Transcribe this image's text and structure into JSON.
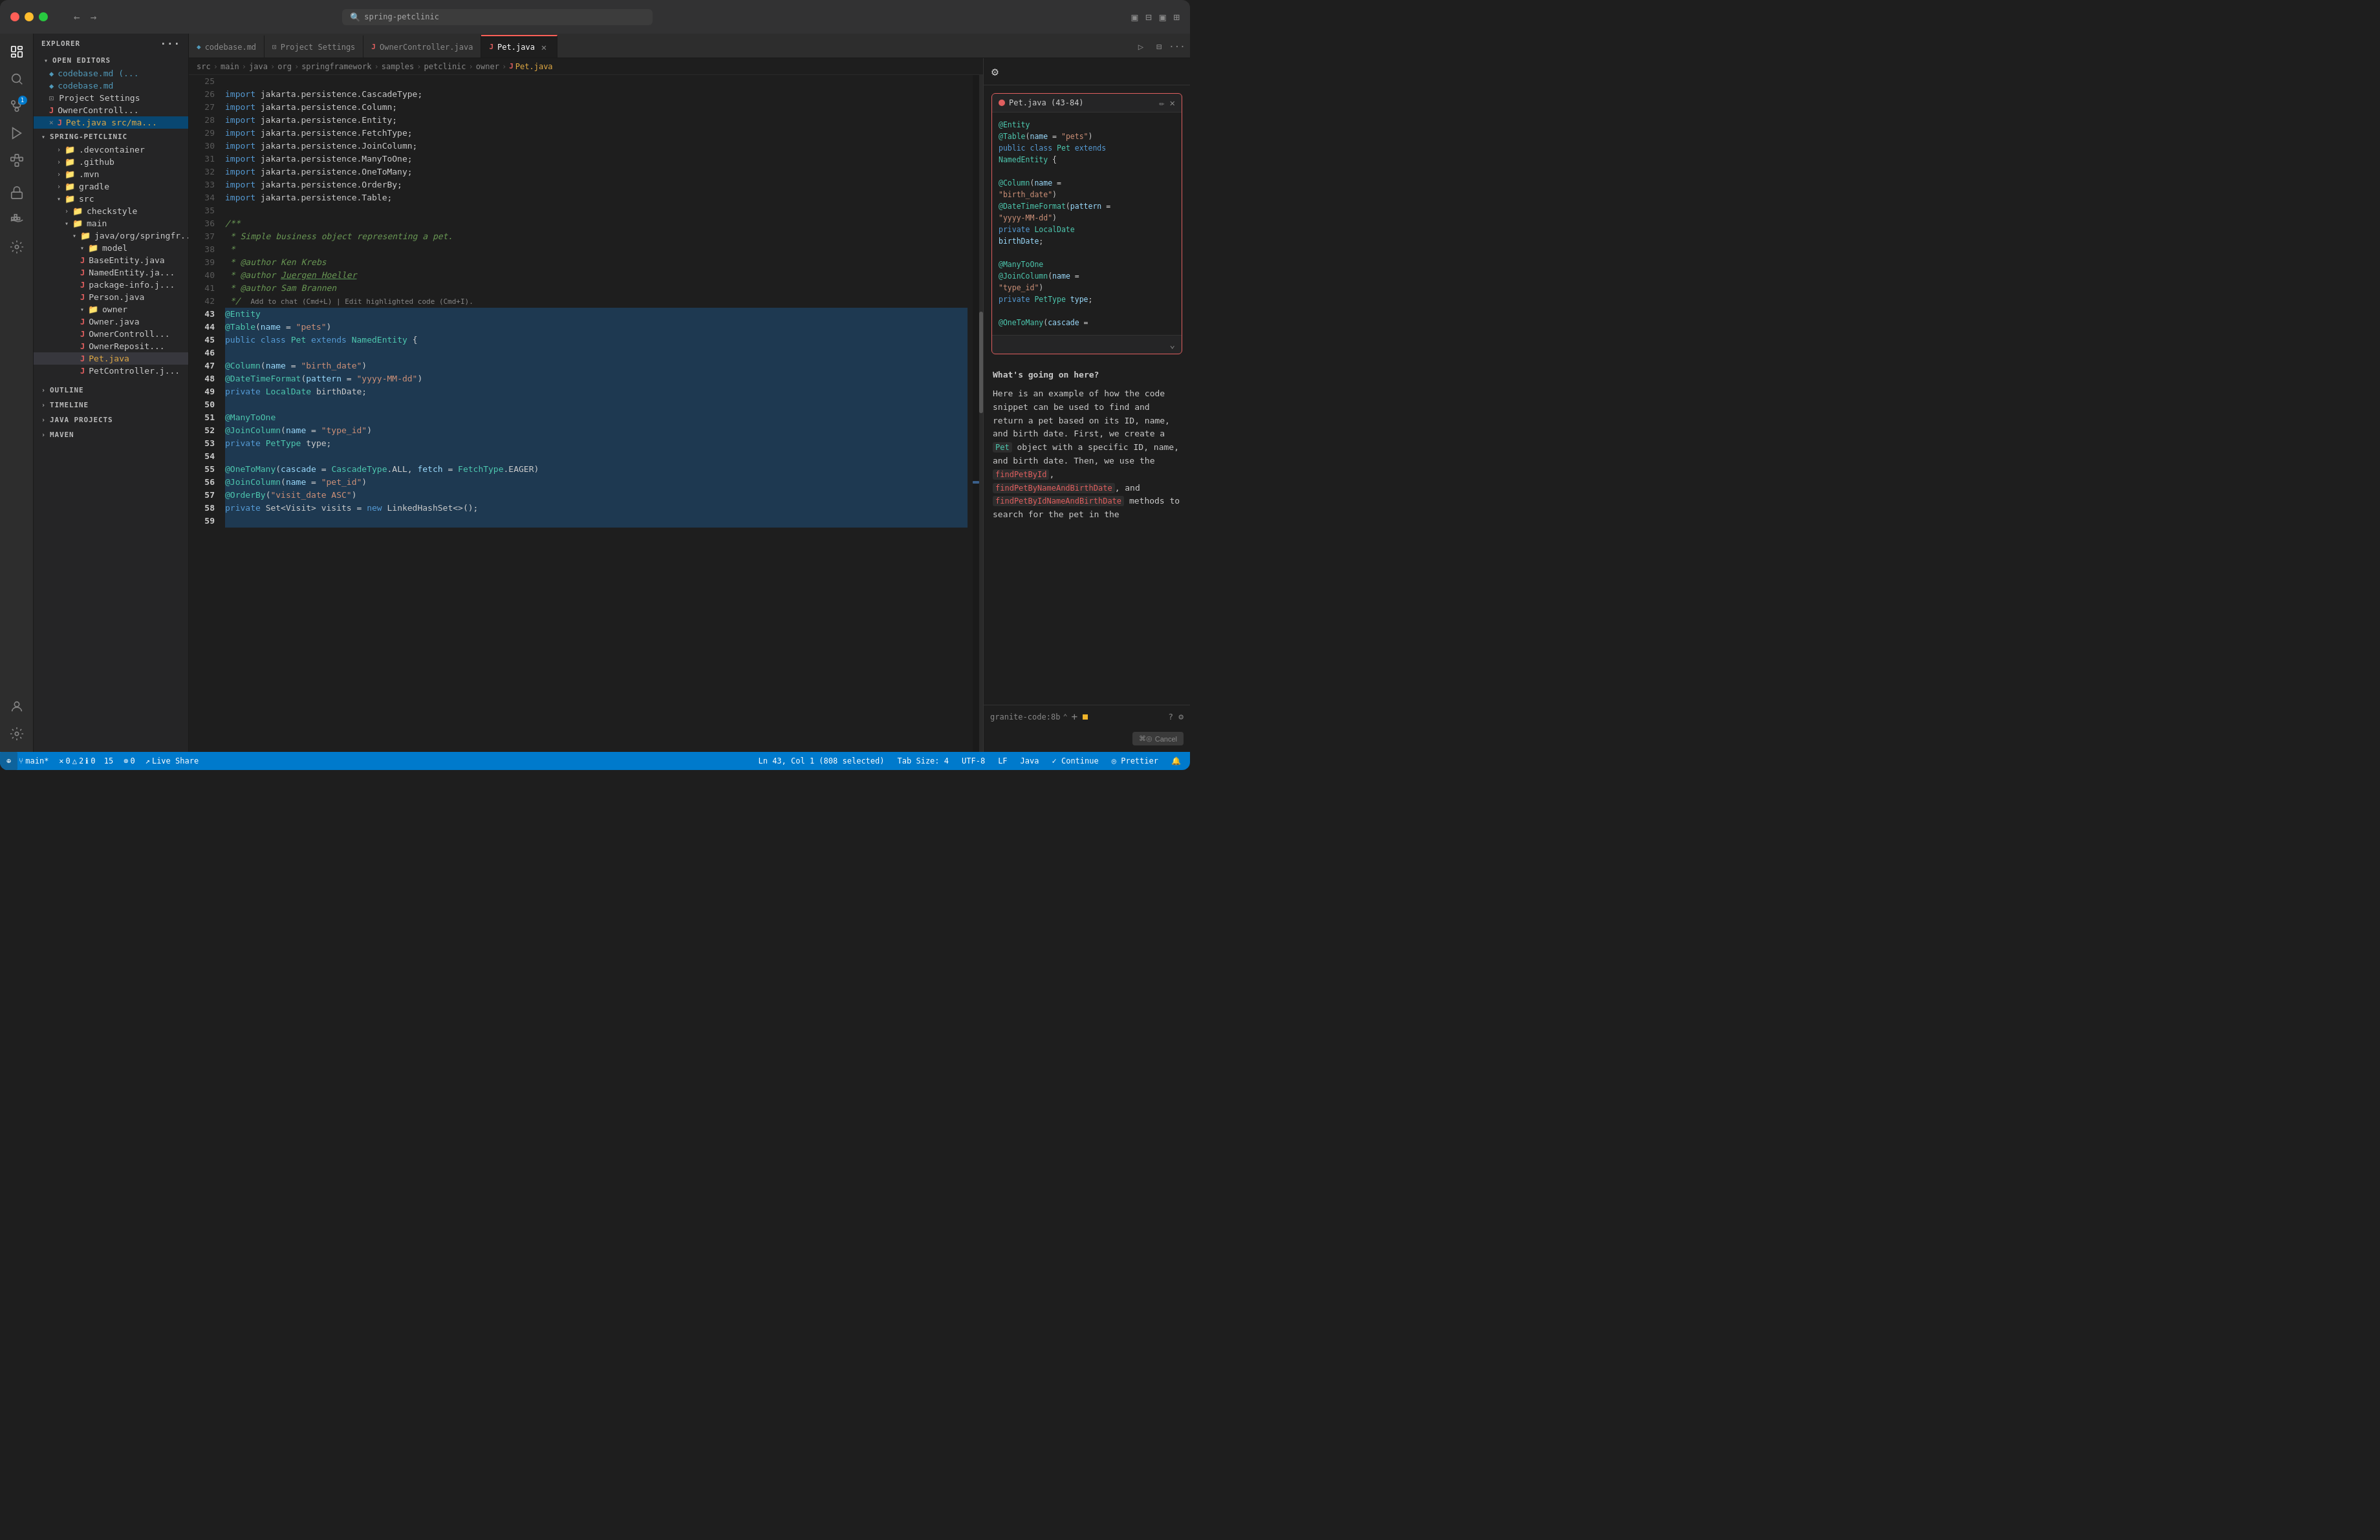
{
  "titlebar": {
    "search_placeholder": "spring-petclinic",
    "nav_back": "←",
    "nav_forward": "→"
  },
  "tabs": {
    "items": [
      {
        "id": "codebase-md",
        "label": "codebase.md",
        "icon": "md",
        "active": false,
        "modified": false
      },
      {
        "id": "project-settings",
        "label": "Project Settings",
        "icon": "settings",
        "active": false,
        "modified": false
      },
      {
        "id": "owner-controller",
        "label": "OwnerController.java",
        "icon": "java",
        "active": false,
        "modified": false
      },
      {
        "id": "pet-java",
        "label": "Pet.java",
        "icon": "java",
        "active": true,
        "modified": true
      }
    ]
  },
  "breadcrumb": {
    "parts": [
      "src",
      "main",
      "java",
      "org",
      "springframework",
      "samples",
      "petclinic",
      "owner",
      "Pet.java"
    ]
  },
  "sidebar": {
    "explorer_label": "EXPLORER",
    "open_editors_label": "OPEN EDITORS",
    "project_label": "SPRING-PETCLINIC",
    "outline_label": "OUTLINE",
    "timeline_label": "TIMELINE",
    "java_projects_label": "JAVA PROJECTS",
    "maven_label": "MAVEN",
    "files": [
      {
        "name": "codebase.md (...",
        "type": "md",
        "indent": 1
      },
      {
        "name": "codebase.md",
        "type": "md",
        "indent": 1
      },
      {
        "name": "Project Settings",
        "type": "settings",
        "indent": 1
      },
      {
        "name": "OwnerControll...",
        "type": "java",
        "indent": 1
      },
      {
        "name": "Pet.java src/ma...",
        "type": "java",
        "indent": 1,
        "active": true,
        "modified": true
      },
      {
        "name": ".devcontainer",
        "type": "folder",
        "indent": 2
      },
      {
        "name": ".github",
        "type": "folder",
        "indent": 2
      },
      {
        "name": ".mvn",
        "type": "folder",
        "indent": 2
      },
      {
        "name": "gradle",
        "type": "folder",
        "indent": 2
      },
      {
        "name": "src",
        "type": "folder",
        "indent": 2,
        "open": true
      },
      {
        "name": "checkstyle",
        "type": "folder",
        "indent": 3
      },
      {
        "name": "main",
        "type": "folder",
        "indent": 3,
        "open": true
      },
      {
        "name": "java/org/springfr...",
        "type": "folder",
        "indent": 4,
        "open": true
      },
      {
        "name": "model",
        "type": "folder",
        "indent": 5,
        "open": true
      },
      {
        "name": "BaseEntity.java",
        "type": "java",
        "indent": 6
      },
      {
        "name": "NamedEntity.ja...",
        "type": "java",
        "indent": 6
      },
      {
        "name": "package-info.j...",
        "type": "java",
        "indent": 6
      },
      {
        "name": "Person.java",
        "type": "java",
        "indent": 6
      },
      {
        "name": "owner",
        "type": "folder",
        "indent": 5,
        "open": true
      },
      {
        "name": "Owner.java",
        "type": "java",
        "indent": 6
      },
      {
        "name": "OwnerControll...",
        "type": "java",
        "indent": 6
      },
      {
        "name": "OwnerReposit...",
        "type": "java",
        "indent": 6
      },
      {
        "name": "Pet.java",
        "type": "java",
        "indent": 6,
        "active": true
      },
      {
        "name": "PetController.j...",
        "type": "java",
        "indent": 6
      }
    ]
  },
  "code": {
    "lines": [
      {
        "num": 25,
        "content": ""
      },
      {
        "num": 26,
        "tokens": [
          {
            "t": "kw",
            "v": "import"
          },
          {
            "t": "punct",
            "v": " jakarta.persistence.CascadeType;"
          }
        ]
      },
      {
        "num": 27,
        "tokens": [
          {
            "t": "kw",
            "v": "import"
          },
          {
            "t": "punct",
            "v": " jakarta.persistence.Column;"
          }
        ]
      },
      {
        "num": 28,
        "tokens": [
          {
            "t": "kw",
            "v": "import"
          },
          {
            "t": "punct",
            "v": " jakarta.persistence.Entity;"
          }
        ]
      },
      {
        "num": 29,
        "tokens": [
          {
            "t": "kw",
            "v": "import"
          },
          {
            "t": "punct",
            "v": " jakarta.persistence.FetchType;"
          }
        ]
      },
      {
        "num": 30,
        "tokens": [
          {
            "t": "kw",
            "v": "import"
          },
          {
            "t": "punct",
            "v": " jakarta.persistence.JoinColumn;"
          }
        ]
      },
      {
        "num": 31,
        "tokens": [
          {
            "t": "kw",
            "v": "import"
          },
          {
            "t": "punct",
            "v": " jakarta.persistence.ManyToOne;"
          }
        ]
      },
      {
        "num": 32,
        "tokens": [
          {
            "t": "kw",
            "v": "import"
          },
          {
            "t": "punct",
            "v": " jakarta.persistence.OneToMany;"
          }
        ]
      },
      {
        "num": 33,
        "tokens": [
          {
            "t": "kw",
            "v": "import"
          },
          {
            "t": "punct",
            "v": " jakarta.persistence.OrderBy;"
          }
        ]
      },
      {
        "num": 34,
        "tokens": [
          {
            "t": "kw",
            "v": "import"
          },
          {
            "t": "punct",
            "v": " jakarta.persistence.Table;"
          }
        ]
      },
      {
        "num": 35,
        "content": ""
      },
      {
        "num": 36,
        "tokens": [
          {
            "t": "comment",
            "v": "/**"
          }
        ]
      },
      {
        "num": 37,
        "tokens": [
          {
            "t": "comment",
            "v": " * Simple business object representing a pet."
          }
        ]
      },
      {
        "num": 38,
        "tokens": [
          {
            "t": "comment",
            "v": " *"
          }
        ]
      },
      {
        "num": 39,
        "tokens": [
          {
            "t": "comment",
            "v": " * @author Ken Krebs"
          }
        ]
      },
      {
        "num": 40,
        "tokens": [
          {
            "t": "comment",
            "v": " * @author Juergen Hoeller"
          }
        ]
      },
      {
        "num": 41,
        "tokens": [
          {
            "t": "comment",
            "v": " * @author Sam Brannen"
          }
        ]
      },
      {
        "num": 42,
        "tokens": [
          {
            "t": "comment",
            "v": " */"
          }
        ],
        "suffix": "     Add to chat (Cmd+L) | Edit highlighted code (Cmd+I)."
      },
      {
        "num": 43,
        "tokens": [
          {
            "t": "ann",
            "v": "@Entity"
          }
        ],
        "highlight": true
      },
      {
        "num": 44,
        "tokens": [
          {
            "t": "ann",
            "v": "@Table"
          },
          {
            "t": "punct",
            "v": "("
          },
          {
            "t": "param",
            "v": "name"
          },
          {
            "t": "punct",
            "v": " = "
          },
          {
            "t": "str",
            "v": "\"pets\""
          },
          {
            "t": "punct",
            "v": ")"
          }
        ],
        "highlight": true
      },
      {
        "num": 45,
        "tokens": [
          {
            "t": "kw",
            "v": "public"
          },
          {
            "t": "punct",
            "v": " "
          },
          {
            "t": "kw",
            "v": "class"
          },
          {
            "t": "punct",
            "v": " "
          },
          {
            "t": "type",
            "v": "Pet"
          },
          {
            "t": "punct",
            "v": " extends "
          },
          {
            "t": "type",
            "v": "NamedEntity"
          },
          {
            "t": "punct",
            "v": " {"
          }
        ],
        "highlight": true
      },
      {
        "num": 46,
        "content": ""
      },
      {
        "num": 47,
        "tokens": [
          {
            "t": "ann",
            "v": "    @Column"
          },
          {
            "t": "punct",
            "v": "("
          },
          {
            "t": "param",
            "v": "name"
          },
          {
            "t": "punct",
            "v": " = "
          },
          {
            "t": "str",
            "v": "\"birth_date\""
          },
          {
            "t": "punct",
            "v": ")"
          }
        ],
        "highlight": true
      },
      {
        "num": 48,
        "tokens": [
          {
            "t": "ann",
            "v": "    @DateTimeFormat"
          },
          {
            "t": "punct",
            "v": "("
          },
          {
            "t": "param",
            "v": "pattern"
          },
          {
            "t": "punct",
            "v": " = "
          },
          {
            "t": "str",
            "v": "\"yyyy-MM-dd\""
          },
          {
            "t": "punct",
            "v": ")"
          }
        ],
        "highlight": true
      },
      {
        "num": 49,
        "tokens": [
          {
            "t": "punct",
            "v": "    "
          },
          {
            "t": "kw",
            "v": "private"
          },
          {
            "t": "punct",
            "v": " "
          },
          {
            "t": "type",
            "v": "LocalDate"
          },
          {
            "t": "punct",
            "v": " birthDate;"
          }
        ],
        "highlight": true
      },
      {
        "num": 50,
        "content": ""
      },
      {
        "num": 51,
        "tokens": [
          {
            "t": "ann",
            "v": "    @ManyToOne"
          }
        ],
        "highlight": true
      },
      {
        "num": 52,
        "tokens": [
          {
            "t": "ann",
            "v": "    @JoinColumn"
          },
          {
            "t": "punct",
            "v": "("
          },
          {
            "t": "param",
            "v": "name"
          },
          {
            "t": "punct",
            "v": " = "
          },
          {
            "t": "str",
            "v": "\"type_id\""
          },
          {
            "t": "punct",
            "v": ")"
          }
        ],
        "highlight": true
      },
      {
        "num": 53,
        "tokens": [
          {
            "t": "punct",
            "v": "    "
          },
          {
            "t": "kw",
            "v": "private"
          },
          {
            "t": "punct",
            "v": " "
          },
          {
            "t": "type",
            "v": "PetType"
          },
          {
            "t": "punct",
            "v": " type;"
          }
        ],
        "highlight": true
      },
      {
        "num": 54,
        "content": ""
      },
      {
        "num": 55,
        "tokens": [
          {
            "t": "ann",
            "v": "    @OneToMany"
          },
          {
            "t": "punct",
            "v": "("
          },
          {
            "t": "param",
            "v": "cascade"
          },
          {
            "t": "punct",
            "v": " = "
          },
          {
            "t": "type",
            "v": "CascadeType"
          },
          {
            "t": "punct",
            "v": ".ALL, "
          },
          {
            "t": "param",
            "v": "fetch"
          },
          {
            "t": "punct",
            "v": " = "
          },
          {
            "t": "type",
            "v": "FetchType"
          },
          {
            "t": "punct",
            "v": ".EAGER)"
          }
        ],
        "highlight": true
      },
      {
        "num": 56,
        "tokens": [
          {
            "t": "ann",
            "v": "    @JoinColumn"
          },
          {
            "t": "punct",
            "v": "("
          },
          {
            "t": "param",
            "v": "name"
          },
          {
            "t": "punct",
            "v": " = "
          },
          {
            "t": "str",
            "v": "\"pet_id\""
          },
          {
            "t": "punct",
            "v": ")"
          }
        ],
        "highlight": true
      },
      {
        "num": 57,
        "tokens": [
          {
            "t": "ann",
            "v": "    @OrderBy"
          },
          {
            "t": "punct",
            "v": "("
          },
          {
            "t": "str",
            "v": "\"visit_date ASC\""
          },
          {
            "t": "punct",
            "v": ")"
          }
        ],
        "highlight": true
      },
      {
        "num": 58,
        "tokens": [
          {
            "t": "punct",
            "v": "    "
          },
          {
            "t": "kw",
            "v": "private"
          },
          {
            "t": "punct",
            "v": " Set<Visit> visits = "
          },
          {
            "t": "kw",
            "v": "new"
          },
          {
            "t": "punct",
            "v": " LinkedHashSet<>();"
          }
        ],
        "highlight": true
      },
      {
        "num": 59,
        "content": ""
      }
    ]
  },
  "ai_panel": {
    "popup_title": "Pet.java (43-84)",
    "popup_code_lines": [
      "@Entity",
      "@Table(name = \"pets\")",
      "public class Pet extends",
      "NamedEntity {",
      "",
      "    @Column(name =",
      "\"birth_date\")",
      "    @DateTimeFormat(pattern =",
      "\"yyyy-MM-dd\")",
      "    private LocalDate",
      "birthDate;",
      "",
      "    @ManyToOne",
      "    @JoinColumn(name =",
      "\"type_id\")",
      "    private PetType type;",
      "",
      "    @OneToMany(cascade ="
    ],
    "question": "What's going on here?",
    "answer_parts": [
      {
        "type": "text",
        "value": "Here is an example of how the code snippet\ncan be used to find and return a pet based\non its ID, name, and birth date. First, we\ncreate a "
      },
      {
        "type": "code",
        "value": "Pet",
        "color": "teal"
      },
      {
        "type": "text",
        "value": " object with a specific ID, name,\nand birth date. Then, we use the\n"
      },
      {
        "type": "code",
        "value": "findPetById",
        "color": "red"
      },
      {
        "type": "text",
        "value": ", "
      },
      {
        "type": "code",
        "value": "findPetByNameAndBirthDate",
        "color": "red"
      },
      {
        "type": "text",
        "value": ",\nand "
      },
      {
        "type": "code",
        "value": "findPetByIdNameAndBirthDate",
        "color": "red"
      },
      {
        "type": "text",
        "value": "\nmethods to search for the pet in the"
      }
    ],
    "footer": {
      "model": "granite-code:8b",
      "cancel_label": "Cancel",
      "cancel_shortcut": "⌘◎"
    }
  },
  "statusbar": {
    "git_branch": "main*",
    "errors": "0",
    "warnings": "2",
    "info": "0",
    "hints": "15",
    "ports": "0",
    "live_share": "Live Share",
    "cursor_pos": "Ln 43, Col 1 (808 selected)",
    "tab_size": "Tab Size: 4",
    "encoding": "UTF-8",
    "line_ending": "LF",
    "language": "Java",
    "continue": "✓ Continue",
    "prettier": "◎ Prettier"
  }
}
